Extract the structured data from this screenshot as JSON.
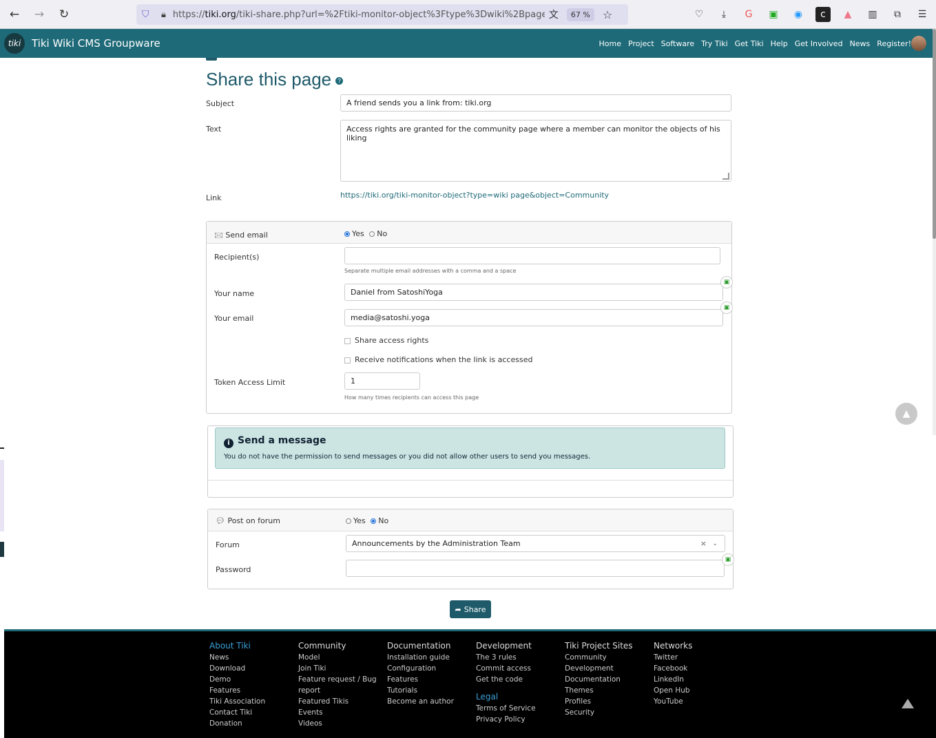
{
  "browser": {
    "url_prefix": "https://",
    "url_host": "tiki.org",
    "url_rest": "/tiki-share.php?url=%2Ftiki-monitor-object%3Ftype%3Dwiki%2Bpage%26",
    "zoom": "67 %"
  },
  "site": {
    "title": "Tiki Wiki CMS Groupware",
    "logo_text": "tiki",
    "nav": [
      "Home",
      "Project",
      "Software",
      "Try Tiki",
      "Get Tiki",
      "Help",
      "Get Involved",
      "News",
      "Register!"
    ]
  },
  "page": {
    "title": "Share this page",
    "help_icon": "?",
    "subject_label": "Subject",
    "subject_value": "A friend sends you a link from:  tiki.org",
    "text_label": "Text",
    "text_value": "Access rights are granted for the community page where a member can monitor the objects of his liking",
    "link_label": "Link",
    "link_value": "https://tiki.org/tiki-monitor-object?type=wiki page&object=Community"
  },
  "email": {
    "header": "Send email",
    "yes": "Yes",
    "no": "No",
    "recipients_label": "Recipient(s)",
    "recipients_value": "",
    "recipients_hint": "Separate multiple email addresses with a comma and a space",
    "name_label": "Your name",
    "name_value": "Daniel from SatoshiYoga",
    "email_label": "Your email",
    "email_value": "media@satoshi.yoga",
    "share_rights": "Share access rights",
    "notify": "Receive notifications when the link is accessed",
    "token_label": "Token Access Limit",
    "token_value": "1",
    "token_hint": "How many times recipients can access this page"
  },
  "message": {
    "title": "Send a message",
    "text": "You do not have the permission to send messages or you did not allow other users to send you messages."
  },
  "forum": {
    "header": "Post on forum",
    "yes": "Yes",
    "no": "No",
    "forum_label": "Forum",
    "forum_value": "Announcements by the Administration Team",
    "password_label": "Password",
    "password_value": ""
  },
  "share_button": "Share",
  "footer": {
    "cols": [
      {
        "head": "About Tiki",
        "items": [
          "News",
          "Download",
          "Demo",
          "Features",
          "Tiki Association",
          "Contact Tiki",
          "Donation"
        ]
      },
      {
        "head": "Community",
        "items": [
          "Model",
          "Join Tiki",
          "Feature request / Bug",
          "report",
          "Featured Tikis",
          "Events",
          "Videos"
        ]
      },
      {
        "head": "Documentation",
        "items": [
          "Installation guide",
          "Configuration",
          "Features",
          "Tutorials",
          "Become an author"
        ]
      },
      {
        "head": "Development",
        "items": [
          "The 3 rules",
          "Commit access",
          "Get the code"
        ]
      },
      {
        "head": "Tiki Project Sites",
        "items": [
          "Community",
          "Development",
          "Documentation",
          "Themes",
          "Profiles",
          "Security"
        ]
      },
      {
        "head": "Networks",
        "items": [
          "Twitter",
          "Facebook",
          "LinkedIn",
          "Open Hub",
          "YouTube"
        ]
      }
    ],
    "legal": {
      "head": "Legal",
      "items": [
        "Terms of Service",
        "Privacy Policy"
      ]
    }
  },
  "colors": {
    "brand": "#1e6a78",
    "info": "#cce5e3"
  }
}
